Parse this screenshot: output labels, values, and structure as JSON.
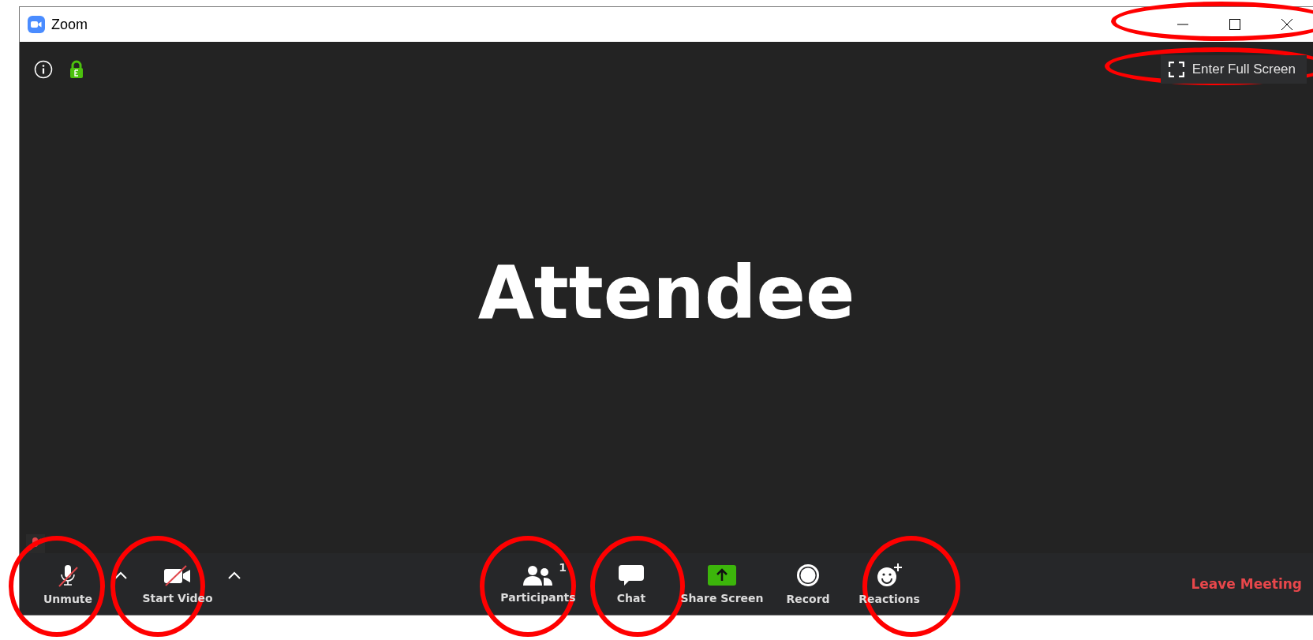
{
  "window": {
    "title": "Zoom"
  },
  "top_bar": {
    "full_screen_button": "Enter Full Screen"
  },
  "video": {
    "name": "Attendee"
  },
  "toolbar": {
    "left": [
      {
        "label": "Unmute",
        "kind": "mic"
      },
      {
        "label": "Start Video",
        "kind": "video"
      }
    ],
    "center": [
      {
        "label": "Participants",
        "kind": "participants",
        "count": "1"
      },
      {
        "label": "Chat",
        "kind": "chat"
      },
      {
        "label": "Share Screen",
        "kind": "share"
      },
      {
        "label": "Record",
        "kind": "record"
      },
      {
        "label": "Reactions",
        "kind": "reactions"
      }
    ],
    "leave": "Leave Meeting"
  }
}
